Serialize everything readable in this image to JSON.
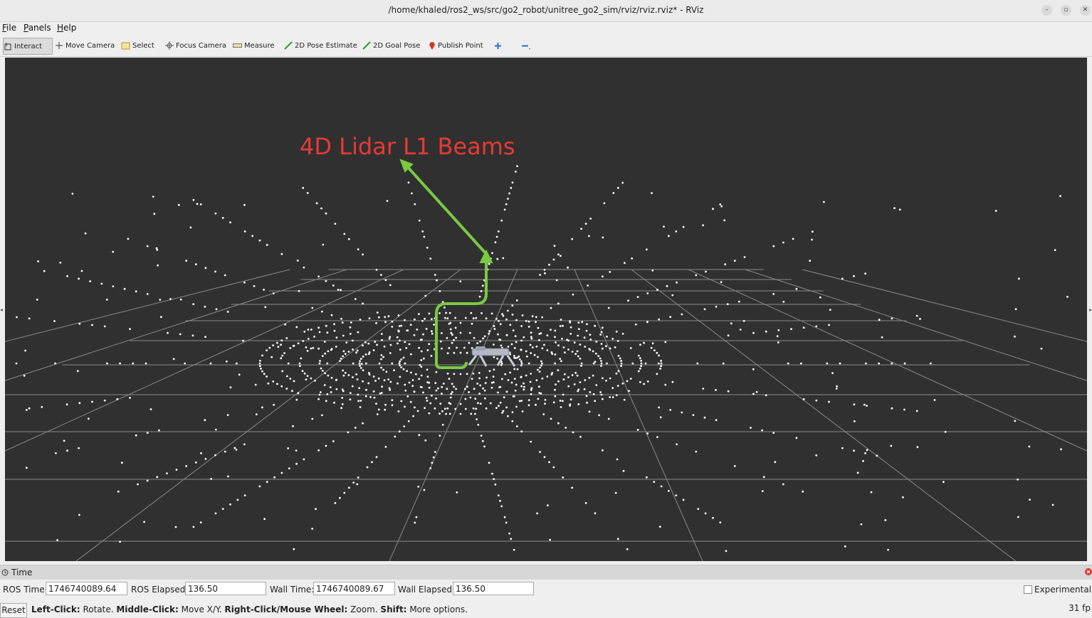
{
  "window": {
    "title": "/home/khaled/ros2_ws/src/go2_robot/unitree_go2_sim/rviz/rviz.rviz* - RViz"
  },
  "menu": {
    "file": "File",
    "panels": "Panels",
    "help": "Help"
  },
  "toolbar": {
    "interact": "Interact",
    "move_camera": "Move Camera",
    "select": "Select",
    "focus_camera": "Focus Camera",
    "measure": "Measure",
    "pose_estimate": "2D Pose Estimate",
    "goal_pose": "2D Goal Pose",
    "publish_point": "Publish Point"
  },
  "viewport": {
    "annotation": "4D Lidar L1 Beams",
    "annotation_color": "#e83a34",
    "arrow_color": "#7ac943",
    "background": "#303030"
  },
  "time_panel": {
    "title": "Time",
    "ros_time_label": "ROS Time:",
    "ros_time": "1746740089.64",
    "ros_elapsed_label": "ROS Elapsed:",
    "ros_elapsed": "136.50",
    "wall_time_label": "Wall Time:",
    "wall_time": "1746740089.67",
    "wall_elapsed_label": "Wall Elapsed:",
    "wall_elapsed": "136.50",
    "experimental_label": "Experimental"
  },
  "status": {
    "reset": "Reset",
    "left_click_key": "Left-Click:",
    "left_click_val": "Rotate.",
    "middle_click_key": "Middle-Click:",
    "middle_click_val": "Move X/Y.",
    "right_click_key": "Right-Click/Mouse Wheel:",
    "right_click_val": "Zoom.",
    "shift_key": "Shift:",
    "shift_val": "More options.",
    "fps": "31 fp"
  }
}
